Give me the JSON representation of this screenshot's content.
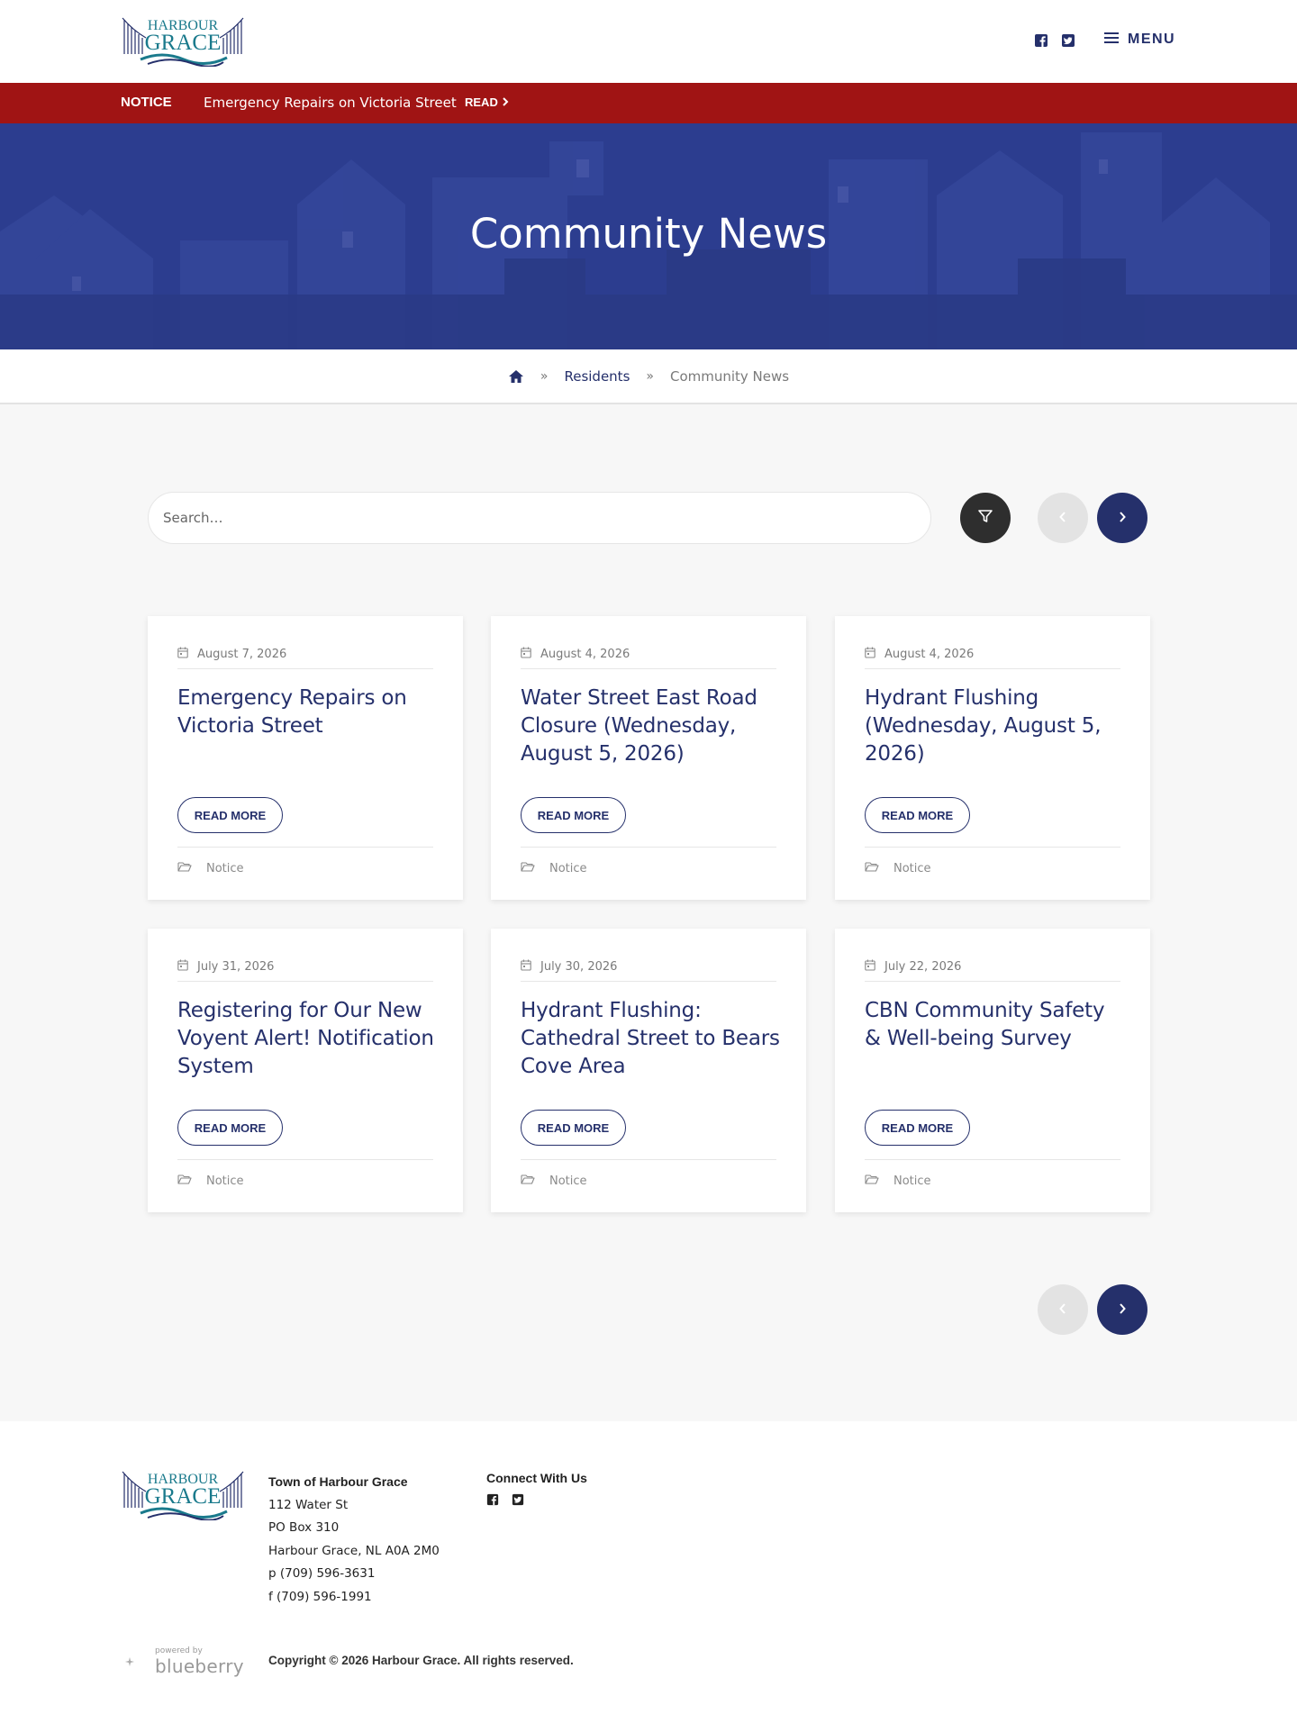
{
  "header": {
    "logo_line1": "HARBOUR",
    "logo_line2": "GRACE",
    "social": [
      "facebook-square-icon",
      "twitter-square-icon"
    ],
    "menu_label": "MENU"
  },
  "notice": {
    "label": "NOTICE",
    "text": "Emergency Repairs on Victoria Street",
    "read": "READ"
  },
  "hero": {
    "title": "Community News"
  },
  "breadcrumb": {
    "home_icon": "home-icon",
    "items": [
      "Residents",
      "Community News"
    ]
  },
  "search": {
    "placeholder": "Search…"
  },
  "icons": {
    "filter": "filter-icon",
    "prev": "chevron-left-icon",
    "next": "chevron-right-icon",
    "calendar": "calendar-icon",
    "folder": "folder-open-icon"
  },
  "articles": [
    {
      "date": "August 7, 2026",
      "title": "Emergency Repairs on Victoria Street",
      "button": "READ MORE",
      "category": "Notice"
    },
    {
      "date": "August 4, 2026",
      "title": "Water Street East Road Closure (Wednesday, August 5, 2026)",
      "button": "READ MORE",
      "category": "Notice"
    },
    {
      "date": "August 4, 2026",
      "title": "Hydrant Flushing (Wednesday, August 5, 2026)",
      "button": "READ MORE",
      "category": "Notice"
    },
    {
      "date": "July 31, 2026",
      "title": "Registering for Our New Voyent Alert! Notification System",
      "button": "READ MORE",
      "category": "Notice"
    },
    {
      "date": "July 30, 2026",
      "title": "Hydrant Flushing: Cathedral Street to Bears Cove Area",
      "button": "READ MORE",
      "category": "Notice"
    },
    {
      "date": "July 22, 2026",
      "title": "CBN Community Safety & Well-being Survey",
      "button": "READ MORE",
      "category": "Notice"
    }
  ],
  "footer": {
    "address": {
      "heading": "Town of Harbour Grace",
      "street": "112 Water St",
      "po_box": "PO Box 310",
      "city": "Harbour Grace, NL A0A 2M0",
      "phone": "p (709) 596-3631",
      "fax": "f (709) 596-1991"
    },
    "connect_heading": "Connect With Us",
    "powered_by_small": "powered by",
    "powered_by_brand": "blueberry",
    "copyright": "Copyright © 2026 Harbour Grace. All rights reserved."
  },
  "colors": {
    "navy": "#25306b",
    "notice_red": "#a01414",
    "hero_blue": "#2c3d8f",
    "teal": "#1a7a8c",
    "page_bg": "#f7f7f7"
  }
}
